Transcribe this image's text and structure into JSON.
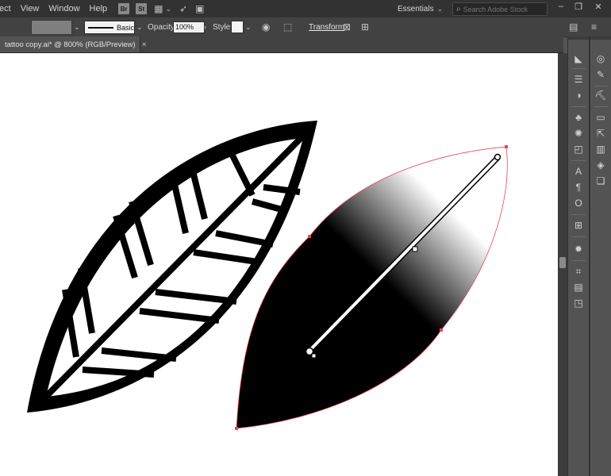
{
  "menubar": {
    "items": [
      "fect",
      "View",
      "Window",
      "Help"
    ],
    "bridge_label": "Br",
    "stock_label": "St",
    "workspace": "Essentials",
    "stock_search_placeholder": "Search Adobe Stock"
  },
  "control_bar": {
    "fill_color": "#7f7f7f",
    "stroke_profile": "Basic",
    "opacity_label": "Opacity:",
    "opacity_value": "100%",
    "style_label": "Style:",
    "transform_label": "Transform"
  },
  "document": {
    "tab_title": "tattoo copy.ai* @ 800% (RGB/Preview)",
    "close_glyph": "×"
  },
  "artwork": {
    "left_leaf": "black outlined leaf with diagonal veins",
    "right_leaf": "leaf with black-to-white linear gradient, selected",
    "selection_color": "#e8455a"
  },
  "panels": {
    "dock_a": [
      "artboards-icon",
      "properties-icon",
      "layers-icon",
      "symbols-icon",
      "brushes-icon",
      "swatches-icon",
      "character-icon",
      "paragraph-icon",
      "opentype-icon",
      "align-icon",
      "pathfinder-icon",
      "transform-panel-icon",
      "align-objects-icon",
      "arrange-icon"
    ],
    "dock_b": [
      "cc-libraries-icon",
      "color-guide-icon",
      "image-trace-icon",
      "links-icon",
      "export-icon",
      "gradient-icon",
      "layers-stack-icon",
      "transparency-icon"
    ]
  }
}
